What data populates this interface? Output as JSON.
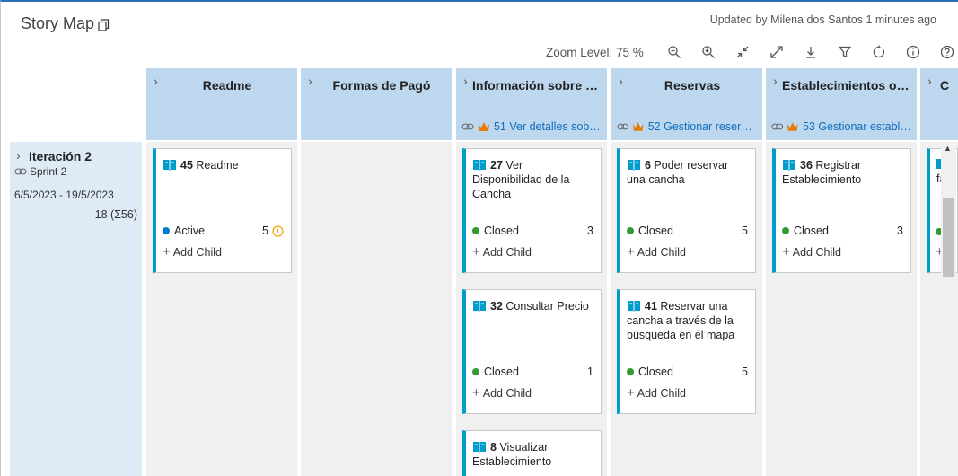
{
  "app": {
    "title": "Story Map",
    "updated": "Updated by Milena dos Santos 1 minutes ago"
  },
  "toolbar": {
    "zoom_label": "Zoom Level: 75 %",
    "icons": [
      "zoom-out-icon",
      "zoom-in-icon",
      "collapse-icon",
      "expand-icon",
      "download-icon",
      "filter-icon",
      "refresh-icon",
      "info-icon",
      "help-icon"
    ]
  },
  "columns": [
    {
      "name": "Readme",
      "epic": ""
    },
    {
      "name": "Formas de Pagó",
      "epic": ""
    },
    {
      "name": "Información sobre c...",
      "epic": "51 Ver detalles sobr..."
    },
    {
      "name": "Reservas",
      "epic": "52 Gestionar reserva..."
    },
    {
      "name": "Establecimientos ofr...",
      "epic": "53 Gestionar estable..."
    },
    {
      "name": "C",
      "epic": ""
    }
  ],
  "iteration": {
    "name": "Iteración 2",
    "sprint": "Sprint 2",
    "dates": "6/5/2023 - 19/5/2023",
    "effort": "18 (Σ56)"
  },
  "cards": [
    {
      "id": "45",
      "title": "Readme",
      "state": "Active",
      "effort": "5",
      "add_child": "Add Child"
    },
    {
      "id": "27",
      "title": "Ver Disponibilidad de la Cancha",
      "state": "Closed",
      "effort": "3",
      "add_child": "Add Child"
    },
    {
      "id": "32",
      "title": "Consultar Precio",
      "state": "Closed",
      "effort": "1",
      "add_child": "Add Child"
    },
    {
      "id": "8",
      "title": "Visualizar Establecimiento",
      "state": "",
      "effort": "",
      "add_child": ""
    },
    {
      "id": "6",
      "title": "Poder reservar una cancha",
      "state": "Closed",
      "effort": "5",
      "add_child": "Add Child"
    },
    {
      "id": "41",
      "title": "Reservar una cancha a través de la búsqueda en el mapa",
      "state": "Closed",
      "effort": "5",
      "add_child": "Add Child"
    },
    {
      "id": "36",
      "title": "Registrar Establecimiento",
      "state": "Closed",
      "effort": "3",
      "add_child": "Add Child"
    },
    {
      "id": "",
      "title": "fa",
      "state": "",
      "effort": "",
      "add_child": ""
    }
  ],
  "colors": {
    "accent": "#2c6fb5",
    "header_bg": "#bdd7ee",
    "row_bg": "#deebf7",
    "card_bar": "#009ccc",
    "active": "#007acc",
    "closed": "#339933",
    "warning": "#f2a600",
    "epic_crown": "#e97b00"
  }
}
